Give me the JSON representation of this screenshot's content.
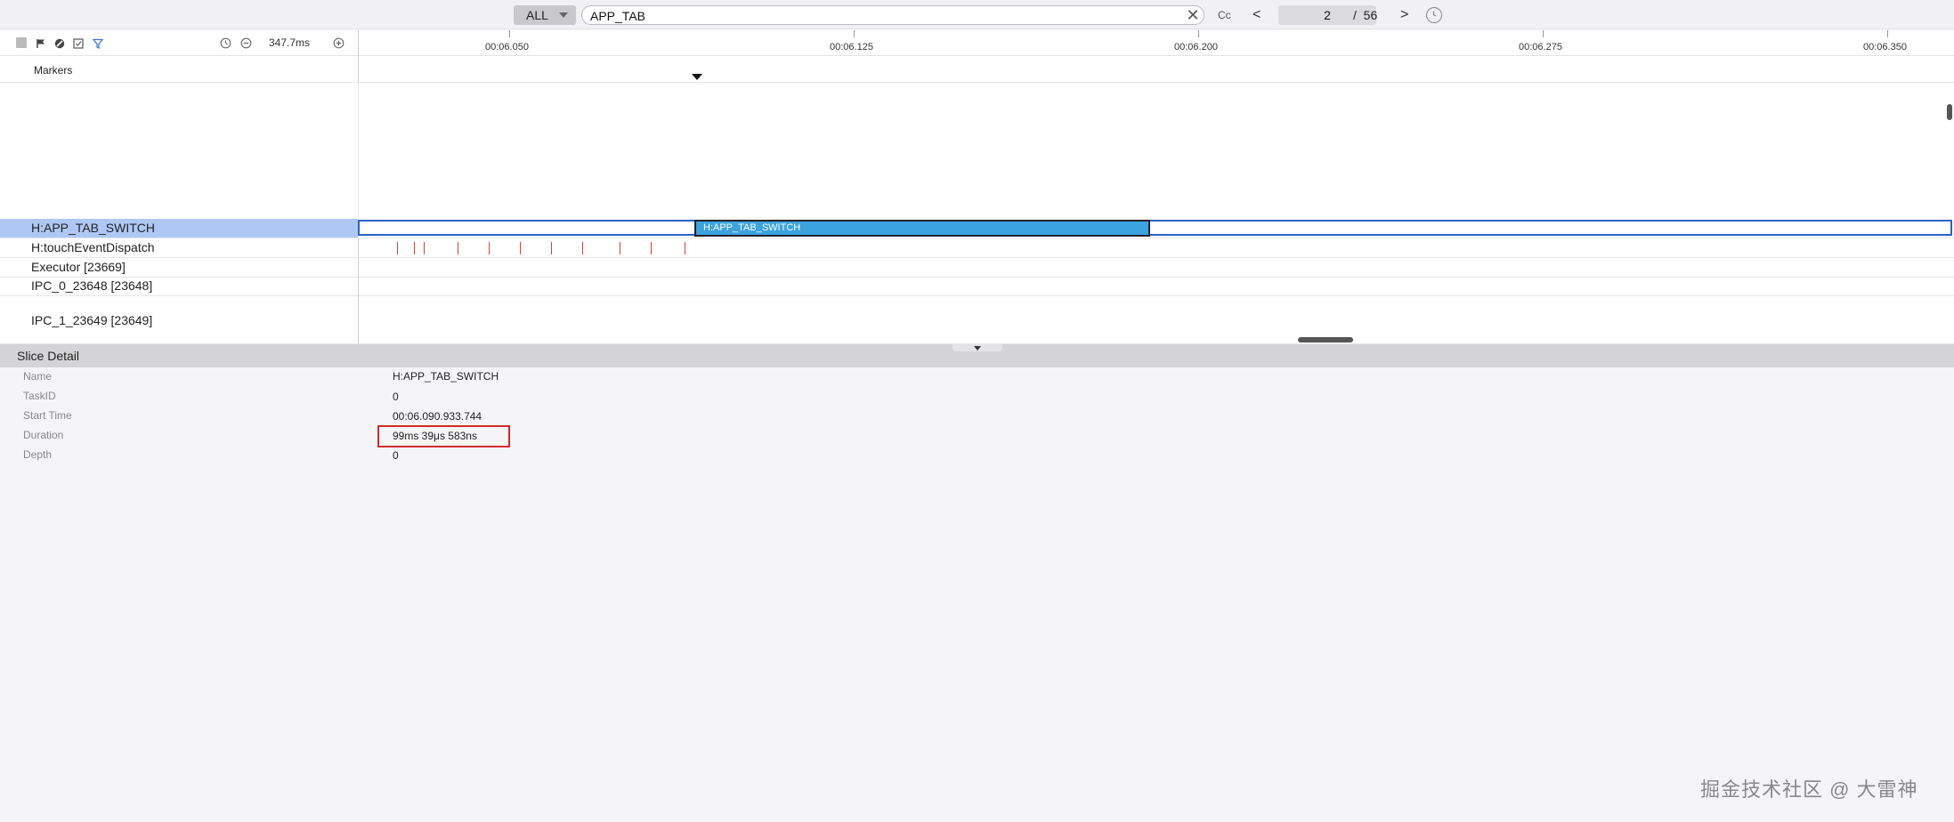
{
  "search": {
    "scope": "ALL",
    "query": "APP_TAB",
    "case_label": "Cc",
    "prev": "<",
    "next": ">",
    "current_match": "2",
    "slash": "/",
    "total_matches": "56",
    "clear_glyph": "✕"
  },
  "toolbar": {
    "zoom_label": "347.7ms",
    "icons": [
      "stop-square-icon",
      "flag-icon",
      "no-entry-icon",
      "screenshot-check-icon",
      "filter-icon",
      "history-clock-icon",
      "zoom-out-icon",
      "zoom-in-icon"
    ]
  },
  "ruler": {
    "ticks": [
      "00:06.050",
      "00:06.125",
      "00:06.200",
      "00:06.275",
      "00:06.350"
    ]
  },
  "markers": {
    "label": "Markers"
  },
  "tracks": {
    "app_tab_switch": "H:APP_TAB_SWITCH",
    "touch_event": "H:touchEventDispatch",
    "executor": "Executor [23669]",
    "ipc0": "IPC_0_23648 [23648]",
    "ipc1": "IPC_1_23649 [23649]",
    "slice_label": "H:APP_TAB_SWITCH"
  },
  "detail": {
    "title": "Slice Detail",
    "rows": [
      {
        "key": "Name",
        "value": "H:APP_TAB_SWITCH"
      },
      {
        "key": "TaskID",
        "value": "0"
      },
      {
        "key": "Start Time",
        "value": "00:06.090.933.744"
      },
      {
        "key": "Duration",
        "value": "99ms 39μs 583ns"
      },
      {
        "key": "Depth",
        "value": "0"
      }
    ]
  },
  "watermark": "掘金技术社区 @ 大雷神",
  "colors": {
    "slice_fill": "#3aa3e0",
    "selected_row": "#aec8f6",
    "selection_border": "#2a62c9",
    "dispatch_tick": "#d1433a",
    "highlight_box": "#d22a2a"
  }
}
